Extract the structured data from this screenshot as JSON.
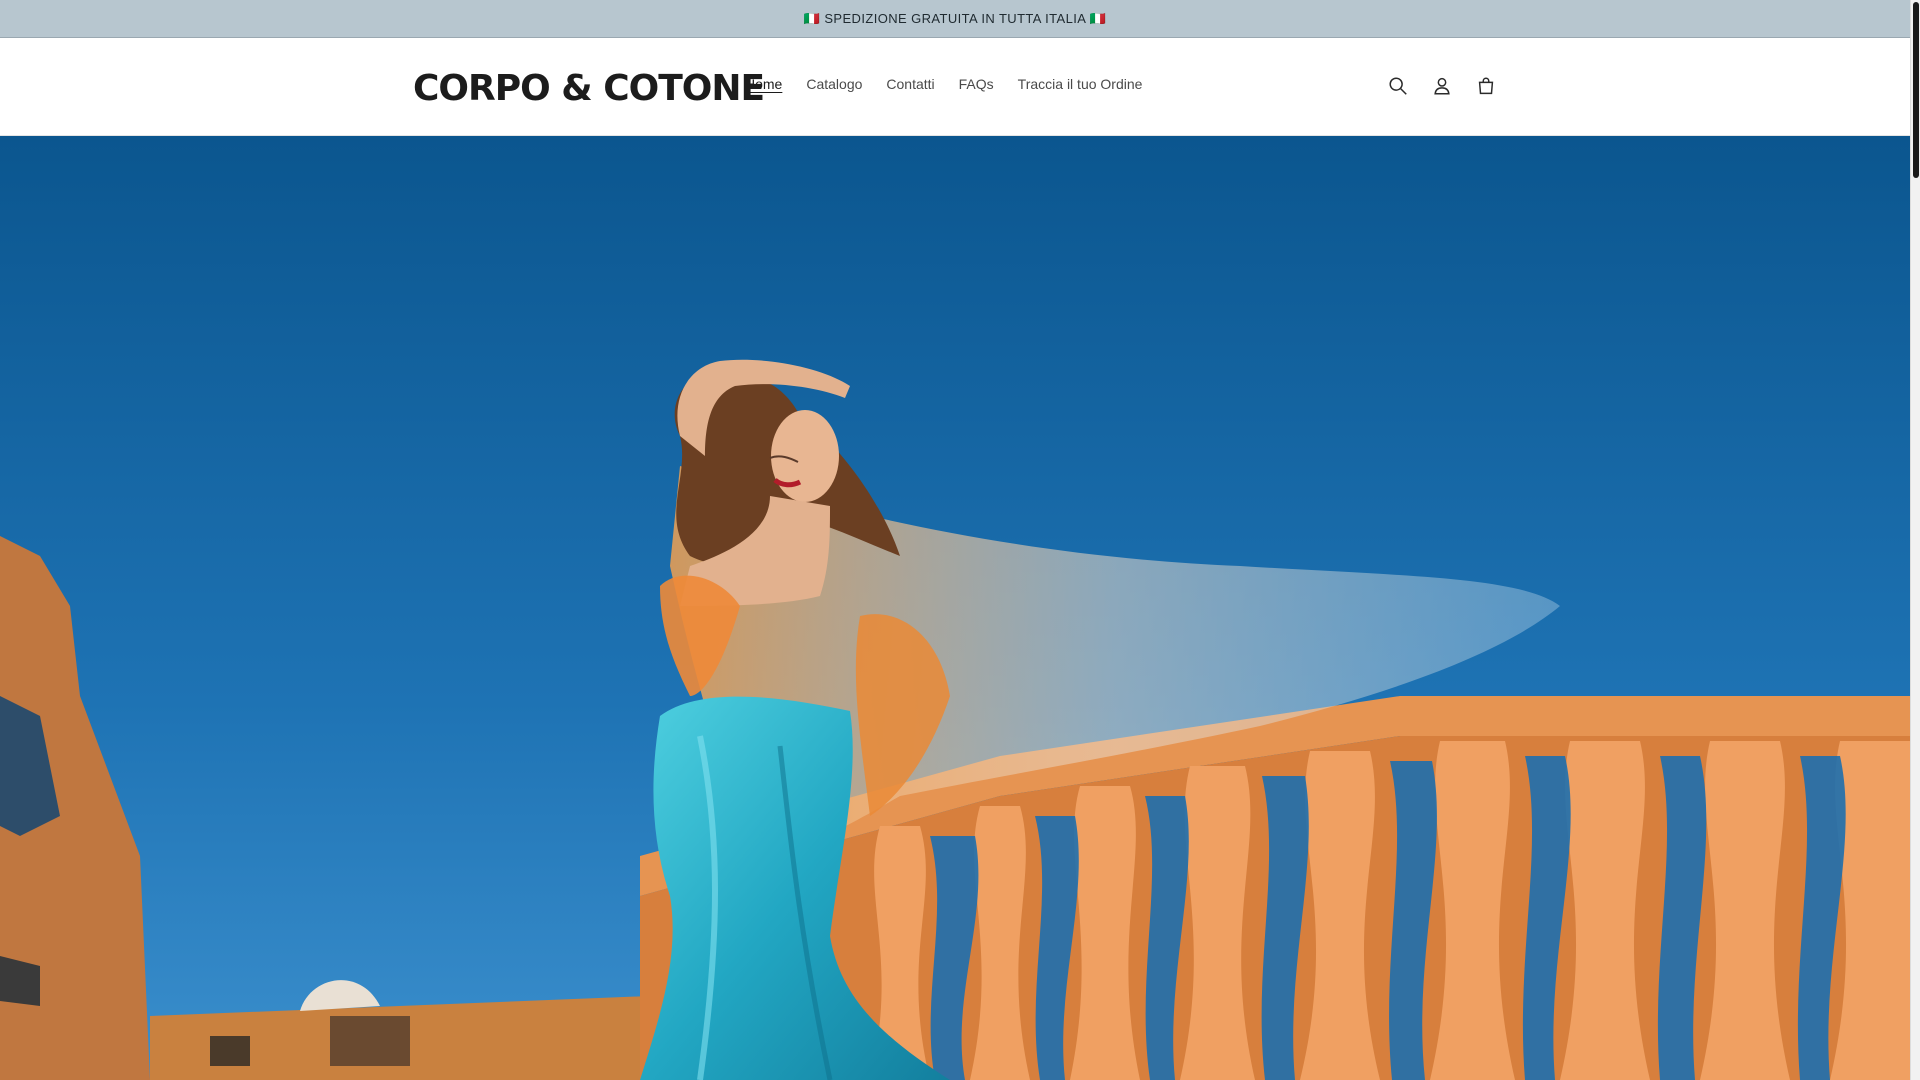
{
  "announcement": {
    "text": "🇮🇹 SPEDIZIONE GRATUITA IN TUTTA ITALIA 🇮🇹"
  },
  "header": {
    "logo": "CORPO & COTONE",
    "nav": [
      {
        "label": "Home",
        "active": true
      },
      {
        "label": "Catalogo",
        "active": false
      },
      {
        "label": "Contatti",
        "active": false
      },
      {
        "label": "FAQs",
        "active": false
      },
      {
        "label": "Traccia il tuo Ordine",
        "active": false
      }
    ],
    "icons": [
      "search-icon",
      "account-icon",
      "cart-icon"
    ]
  },
  "hero": {
    "image_subject": "woman-in-turquoise-satin-gown-with-sheer-veil",
    "colors": {
      "sky_top": "#0f5f99",
      "sky_bottom": "#2f86c8",
      "balustrade": "#e08a4a",
      "building": "#c7793f",
      "dress": "#2fb2c8"
    }
  },
  "colors": {
    "announcement_bg": "#b7c6cf",
    "text_dark": "#1c1c1c",
    "nav_text": "#4a4a4a"
  }
}
